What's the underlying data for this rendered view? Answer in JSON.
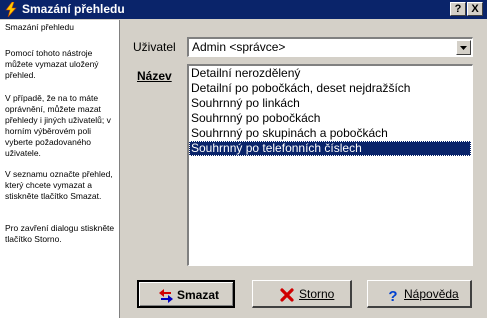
{
  "window": {
    "title": "Smazání přehledu",
    "help_button": "?",
    "close_button": "X"
  },
  "sidepanel": {
    "heading": "Smazání přehledu",
    "paragraphs": [
      "Pomocí tohoto nástroje můžete vymazat uložený přehled.",
      "V případě, že na to máte oprávnění, můžete mazat přehledy i jiných uživatelů; v horním výběrovém poli vyberte požadovaného uživatele.",
      "V seznamu označte přehled, který chcete vymazat a stiskněte tlačítko Smazat.",
      "Pro zavření dialogu stiskněte tlačítko Storno."
    ]
  },
  "form": {
    "user_label": "Uživatel",
    "user_value": "Admin <správce>",
    "name_label": "Název",
    "items": [
      "Detailní nerozdělený",
      "Detailní po pobočkách, deset nejdražších",
      "Souhrnný po linkách",
      "Souhrnný po pobočkách",
      "Souhrnný po skupinách a pobočkách",
      "Souhrnný po telefonních číslech"
    ],
    "selected_index": 5
  },
  "buttons": {
    "delete": "Smazat",
    "cancel": "Storno",
    "help": "Nápověda"
  },
  "colors": {
    "title_bar": "#0a246a",
    "selection": "#0a246a",
    "face": "#d4d0c8"
  },
  "icons": {
    "app": "lightning-icon",
    "delete": "delete-arrows-icon",
    "cancel": "red-x-icon",
    "help": "question-mark-icon",
    "dropdown": "chevron-down-icon"
  }
}
